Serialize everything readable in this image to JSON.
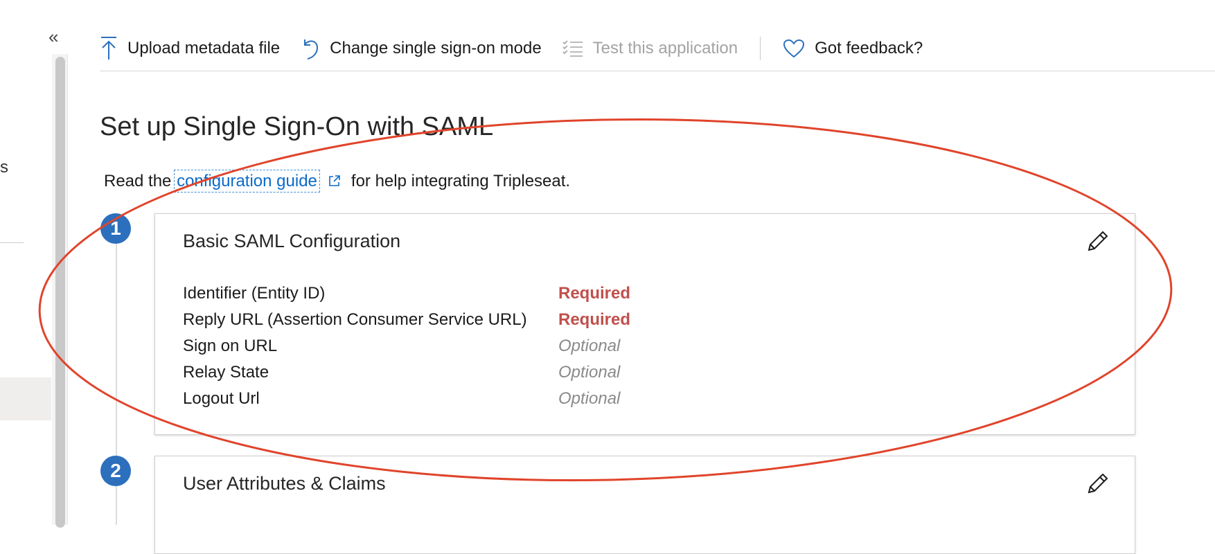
{
  "collapse_glyph": "«",
  "left_panel": {
    "cut_text": "s"
  },
  "toolbar": {
    "items": [
      {
        "label": "Upload metadata file",
        "icon": "upload-icon",
        "disabled": false
      },
      {
        "label": "Change single sign-on mode",
        "icon": "undo-icon",
        "disabled": false
      },
      {
        "label": "Test this application",
        "icon": "checklist-icon",
        "disabled": true
      },
      {
        "label": "Got feedback?",
        "icon": "heart-icon",
        "disabled": false
      }
    ]
  },
  "page": {
    "title": "Set up Single Sign-On with SAML",
    "intro_prefix": "Read the",
    "intro_link": "configuration guide",
    "intro_suffix": "for help integrating Tripleseat."
  },
  "steps": [
    {
      "number": "1",
      "title": "Basic SAML Configuration",
      "rows": [
        {
          "label": "Identifier (Entity ID)",
          "value": "Required",
          "status": "required"
        },
        {
          "label": "Reply URL (Assertion Consumer Service URL)",
          "value": "Required",
          "status": "required"
        },
        {
          "label": "Sign on URL",
          "value": "Optional",
          "status": "optional"
        },
        {
          "label": "Relay State",
          "value": "Optional",
          "status": "optional"
        },
        {
          "label": "Logout Url",
          "value": "Optional",
          "status": "optional"
        }
      ]
    },
    {
      "number": "2",
      "title": "User Attributes & Claims"
    }
  ],
  "colors": {
    "accent": "#0b6ac9",
    "step_badge": "#2c6fbd",
    "required": "#c0504d",
    "optional": "#8a8a8a",
    "annotation_ellipse": "#e0442b"
  }
}
